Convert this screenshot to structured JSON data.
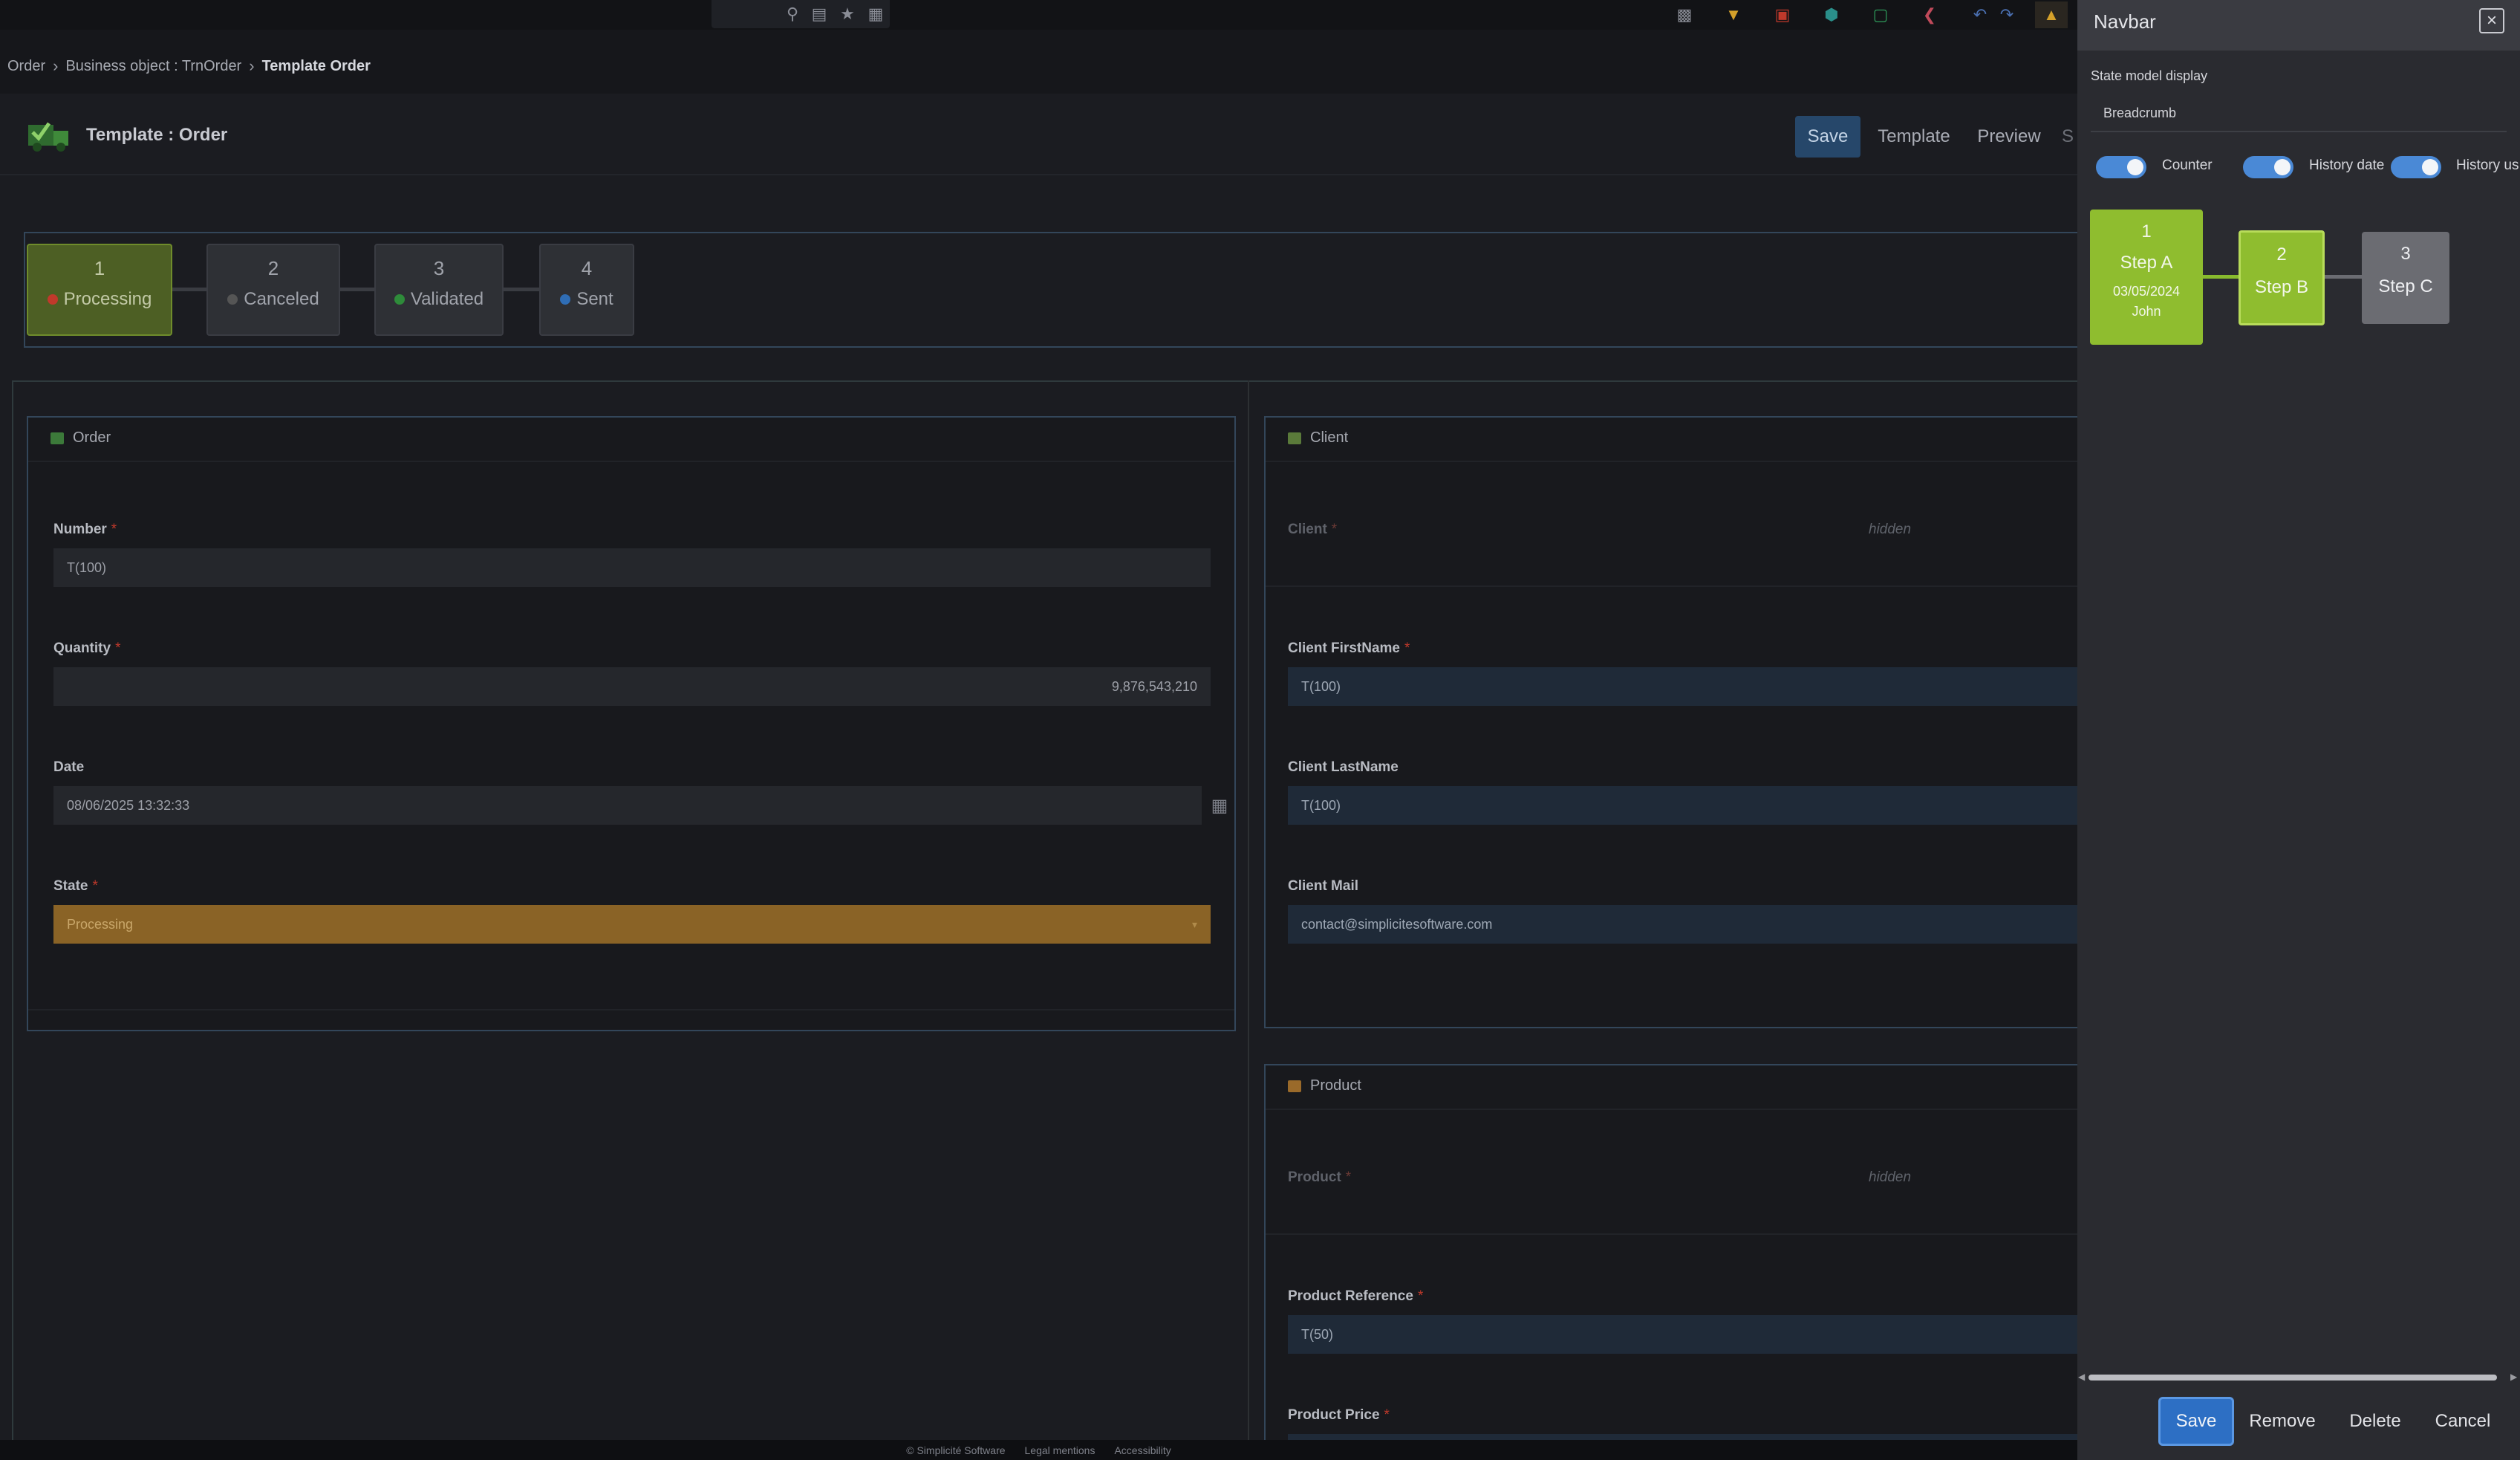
{
  "breadcrumb": [
    "Order",
    "Business object : TrnOrder",
    "Template Order"
  ],
  "toolbar_left": [
    "search-icon",
    "calendar-icon",
    "star-icon",
    "grid-icon"
  ],
  "toolbar_right": [
    "robot-icon",
    "funnel-icon",
    "flag-icon",
    "cube-icon",
    "monitor-icon",
    "share-icon",
    "undo-icon",
    "redo-icon",
    "user-avatar-icon"
  ],
  "page": {
    "title": "Template : Order",
    "actions": {
      "save": "Save",
      "template": "Template",
      "preview": "Preview"
    }
  },
  "steps": [
    {
      "num": "1",
      "label": "Processing",
      "dot_color": "#c0392b",
      "active": true
    },
    {
      "num": "2",
      "label": "Canceled",
      "dot_color": "#555555",
      "active": false
    },
    {
      "num": "3",
      "label": "Validated",
      "dot_color": "#2e8b3a",
      "active": false
    },
    {
      "num": "4",
      "label": "Sent",
      "dot_color": "#2f6db5",
      "active": false
    }
  ],
  "order_section": {
    "title": "Order",
    "number": {
      "label": "Number",
      "value": "T(100)"
    },
    "quantity": {
      "label": "Quantity",
      "value": "9,876,543,210"
    },
    "date": {
      "label": "Date",
      "value": "08/06/2025 13:32:33"
    },
    "state": {
      "label": "State",
      "value": "Processing"
    }
  },
  "client_section": {
    "title": "Client",
    "client": {
      "label": "Client",
      "value": "hidden"
    },
    "firstname": {
      "label": "Client FirstName",
      "value": "T(100)"
    },
    "lastname": {
      "label": "Client LastName",
      "value": "T(100)"
    },
    "mail": {
      "label": "Client Mail",
      "value": "contact@simplicitesoftware.com"
    }
  },
  "product_section": {
    "title": "Product",
    "product": {
      "label": "Product",
      "value": "hidden"
    },
    "reference": {
      "label": "Product Reference",
      "value": "T(50)"
    },
    "price": {
      "label": "Product Price"
    }
  },
  "required_mark": "*",
  "footer": [
    "© Simplicité Software",
    "Legal mentions",
    "Accessibility"
  ],
  "dialog": {
    "title": "Navbar",
    "close_icon": "×",
    "subtitle": "State model display",
    "select_value": "Breadcrumb",
    "toggles": [
      {
        "label": "Counter",
        "on": true
      },
      {
        "label": "History date",
        "on": true
      },
      {
        "label": "History us",
        "on": true
      }
    ],
    "preview": [
      {
        "num": "1",
        "label": "Step A",
        "date": "03/05/2024",
        "user": "John"
      },
      {
        "num": "2",
        "label": "Step B"
      },
      {
        "num": "3",
        "label": "Step C"
      }
    ],
    "buttons": {
      "save": "Save",
      "remove": "Remove",
      "delete": "Delete",
      "cancel": "Cancel"
    }
  },
  "colors": {
    "accent_blue": "#2d6fc4",
    "step_active": "#4d5f24",
    "preview_green": "#8fbd2f",
    "state_field": "#8a6326"
  }
}
